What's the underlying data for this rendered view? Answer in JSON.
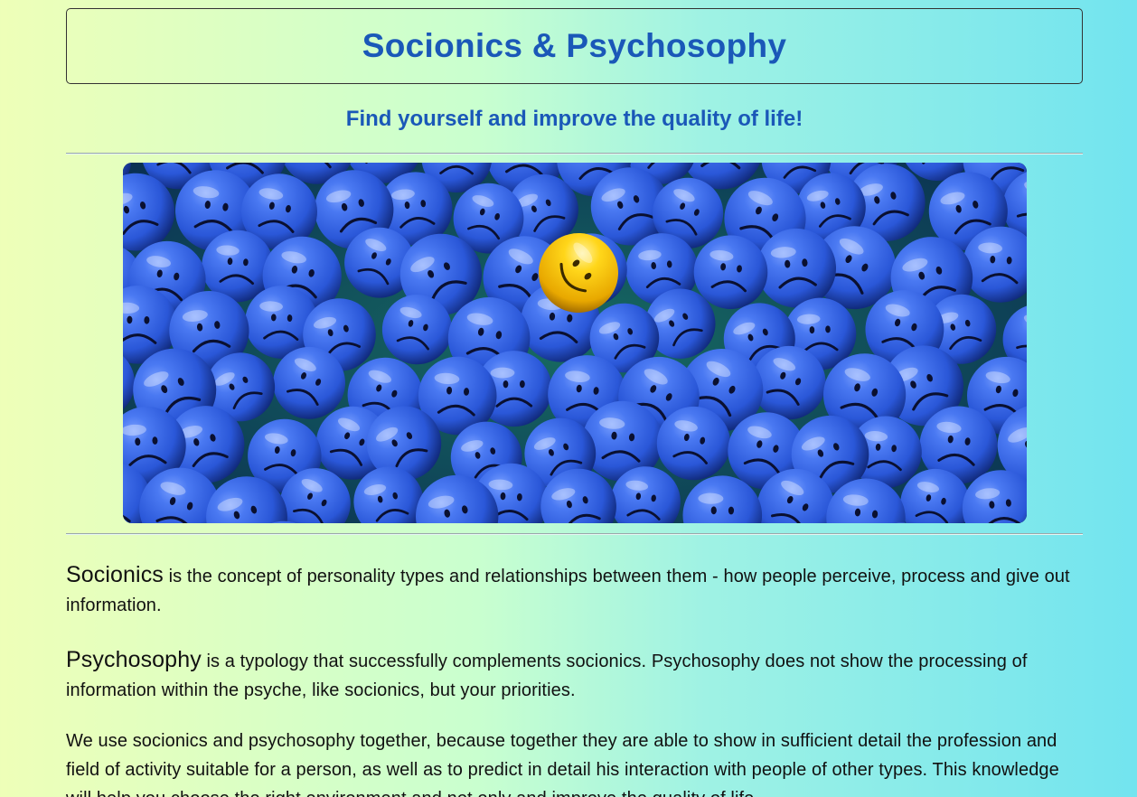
{
  "header": {
    "title": "Socionics & Psychosophy"
  },
  "tagline": "Find yourself and improve the quality of life!",
  "hero": {
    "description_icon": "blue-sad-faces-with-one-yellow-smiley-image",
    "colors": {
      "face": "#2f63e6",
      "smiley": "#f5c400"
    }
  },
  "content": {
    "p1_term": "Socionics",
    "p1_text": " is the concept of personality types and relationships between them - how people perceive, process and give out information.",
    "p2_term": "Psychosophy",
    "p2_text": " is a typology that successfully complements socionics. Psychosophy does not show the processing of information within the psyche, like socionics, but your priorities.",
    "p3_text": "We use socionics and psychosophy together, because together they are able to show in sufficient detail the profession and field of activity suitable for a person, as well as to predict in detail his interaction with people of other types. This knowledge will help you choose the right environment and not only and improve the quality of life."
  },
  "colors": {
    "title": "#1a58b8",
    "gradient_left": "#eeffb8",
    "gradient_right": "#72e4ef"
  }
}
